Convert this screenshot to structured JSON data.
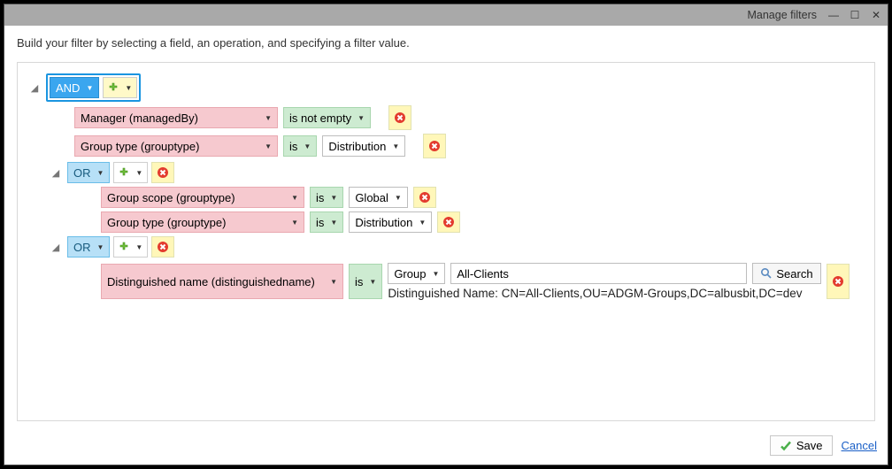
{
  "window": {
    "title": "Manage filters"
  },
  "instructions": "Build your filter by selecting a field, an operation, and specifying a filter value.",
  "ops": {
    "and": "AND",
    "or": "OR"
  },
  "buttons": {
    "search": "Search",
    "save": "Save",
    "cancel": "Cancel"
  },
  "root": {
    "op": "AND",
    "rules": [
      {
        "field": "Manager (managedBy)",
        "operation": "is not empty"
      },
      {
        "field": "Group type (grouptype)",
        "operation": "is",
        "value": "Distribution"
      }
    ],
    "groups": [
      {
        "op": "OR",
        "rules": [
          {
            "field": "Group scope (grouptype)",
            "operation": "is",
            "value": "Global"
          },
          {
            "field": "Group type (grouptype)",
            "operation": "is",
            "value": "Distribution"
          }
        ]
      },
      {
        "op": "OR",
        "dn_rule": {
          "field": "Distinguished name (distinguishedname)",
          "operation": "is",
          "target_type": "Group",
          "target_name": "All-Clients",
          "dn_text": "Distinguished Name: CN=All-Clients,OU=ADGM-Groups,DC=albusbit,DC=dev"
        }
      }
    ]
  }
}
